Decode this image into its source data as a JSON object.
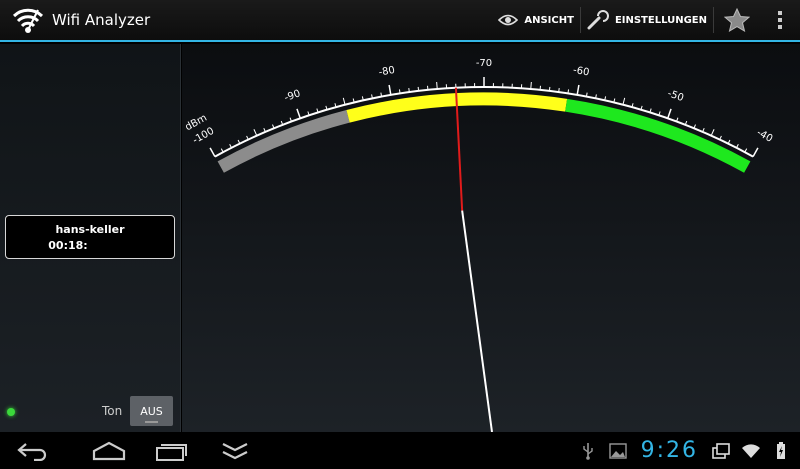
{
  "app": {
    "title": "Wifi Analyzer"
  },
  "actions": {
    "view_label": "ANSICHT",
    "settings_label": "EINSTELLUNGEN"
  },
  "network": {
    "ssid": "hans-keller",
    "mac": "00:18:"
  },
  "tone": {
    "label": "Ton",
    "state": "AUS"
  },
  "meter": {
    "unit": "dBm",
    "min": -100,
    "max": -40,
    "tick_labels": [
      "-100",
      "-90",
      "-80",
      "-70",
      "-60",
      "-50",
      "-40"
    ],
    "reading": -73,
    "zones": [
      {
        "from": -100,
        "to": -85,
        "color": "#8c8c8c"
      },
      {
        "from": -85,
        "to": -61,
        "color": "#ffff1a"
      },
      {
        "from": -61,
        "to": -40,
        "color": "#1ee81e"
      }
    ],
    "needle_color": "#e11b1b",
    "needle_base_color": "#ffffff"
  },
  "status": {
    "clock": "9:26"
  },
  "colors": {
    "accent": "#33b5e5"
  }
}
